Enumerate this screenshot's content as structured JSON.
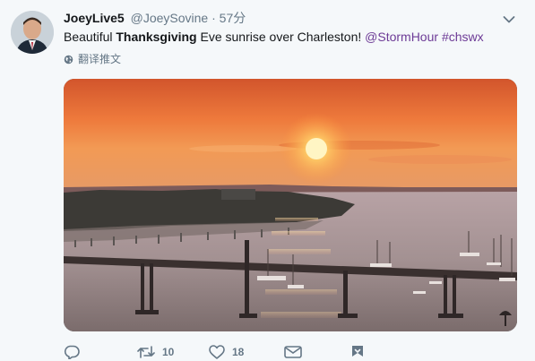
{
  "tweet": {
    "display_name": "JoeyLive5",
    "handle": "@JoeySovine",
    "separator": "·",
    "time": "57分",
    "text": {
      "part1": "Beautiful ",
      "bold": "Thanksgiving",
      "part2": " Eve sunrise over Charleston! ",
      "mention": "@StormHour",
      "space": " ",
      "hashtag": "#chswx"
    },
    "translate_label": "翻译推文",
    "media_alt": "Sunrise over Charleston harbor with bridge and sailboats",
    "actions": {
      "reply_count": "",
      "retweet_count": "10",
      "like_count": "18"
    }
  },
  "colors": {
    "link": "#6d3b96",
    "secondary_text": "#657786",
    "background": "#f5f8fa"
  },
  "icons": [
    "chevron-down-icon",
    "globe-icon",
    "reply-icon",
    "retweet-icon",
    "heart-icon",
    "envelope-icon",
    "bookmark-icon"
  ]
}
